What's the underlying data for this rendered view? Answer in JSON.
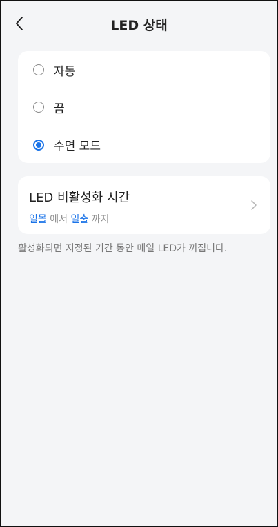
{
  "header": {
    "title": "LED 상태",
    "back_icon": "chevron-left-icon"
  },
  "led_mode": {
    "selected": "수면 모드",
    "options": [
      {
        "label": "자동",
        "checked": false
      },
      {
        "label": "끔",
        "checked": false
      },
      {
        "label": "수면 모드",
        "checked": true
      }
    ]
  },
  "deactivation": {
    "title": "LED 비활성화 시간",
    "start": "일몰",
    "from_word": "에서",
    "end": "일출",
    "to_word": "까지",
    "chevron_icon": "chevron-right-icon"
  },
  "description": "활성화되면 지정된 기간 동안 매일 LED가 꺼집니다.",
  "colors": {
    "accent": "#1a73e8",
    "background": "#f4f5f7",
    "card": "#ffffff"
  }
}
